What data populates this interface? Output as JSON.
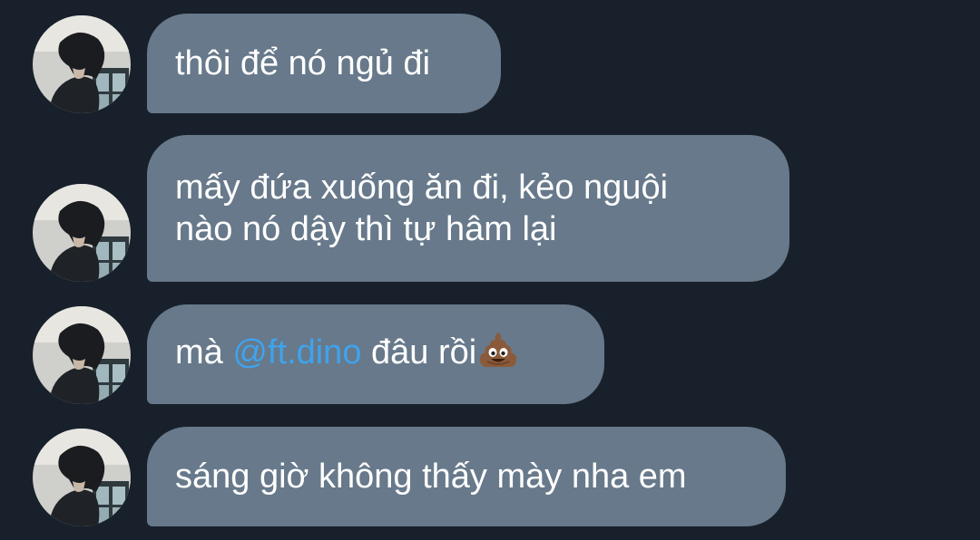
{
  "theme": {
    "background": "#18202b",
    "bubble": "#67798a",
    "text": "#ffffff",
    "mention": "#3fa3ec"
  },
  "messages": [
    {
      "lines": [
        "thôi để nó ngủ đi"
      ]
    },
    {
      "lines": [
        "mấy đứa xuống ăn đi, kẻo nguội",
        "nào nó dậy thì tự hâm lại"
      ]
    },
    {
      "before": "mà ",
      "mention": "@ft.dino",
      "after": " đâu rồi",
      "emoji": "pile-of-poo"
    },
    {
      "lines": [
        "sáng giờ không thấy mày nha em"
      ]
    }
  ]
}
